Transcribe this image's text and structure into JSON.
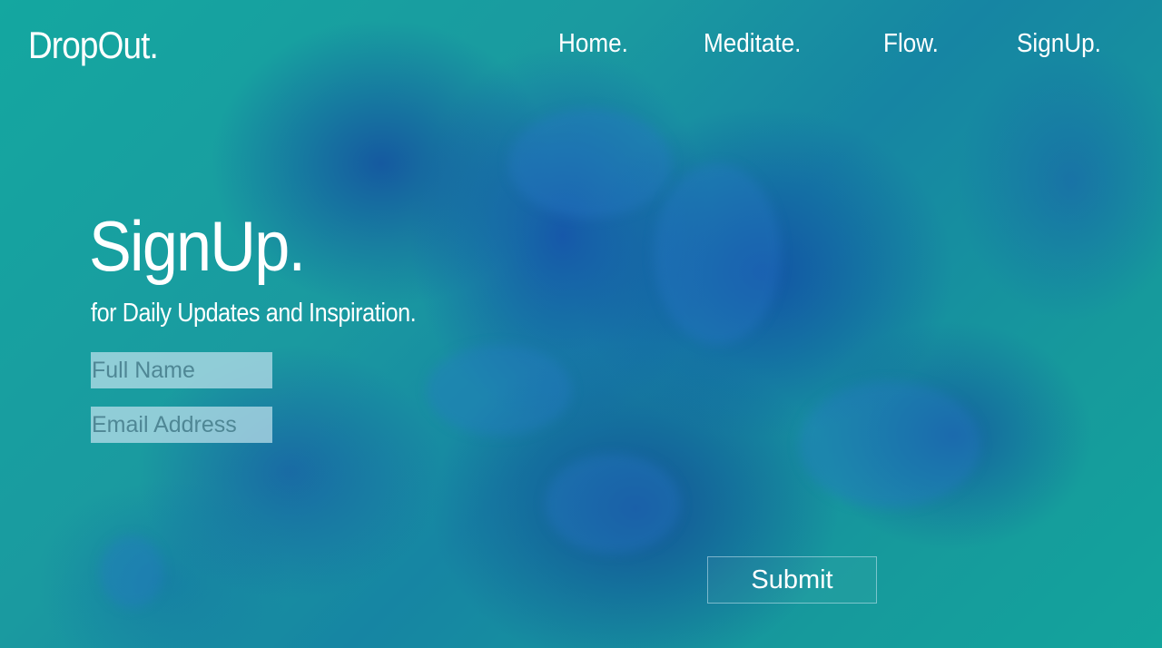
{
  "brand": {
    "name": "DropOut."
  },
  "nav": {
    "items": [
      {
        "label": "Home."
      },
      {
        "label": "Meditate."
      },
      {
        "label": "Flow."
      },
      {
        "label": "SignUp."
      }
    ]
  },
  "hero": {
    "title": "SignUp.",
    "subtitle": "for Daily Updates and Inspiration."
  },
  "form": {
    "full_name": {
      "value": "",
      "placeholder": "Full Name"
    },
    "email": {
      "value": "",
      "placeholder": "Email Address"
    },
    "submit_label": "Submit"
  },
  "colors": {
    "text": "#ffffff",
    "background_teal": "#17a19c",
    "ink_blue": "#1a5aa8",
    "input_fill": "#bee1eb"
  }
}
